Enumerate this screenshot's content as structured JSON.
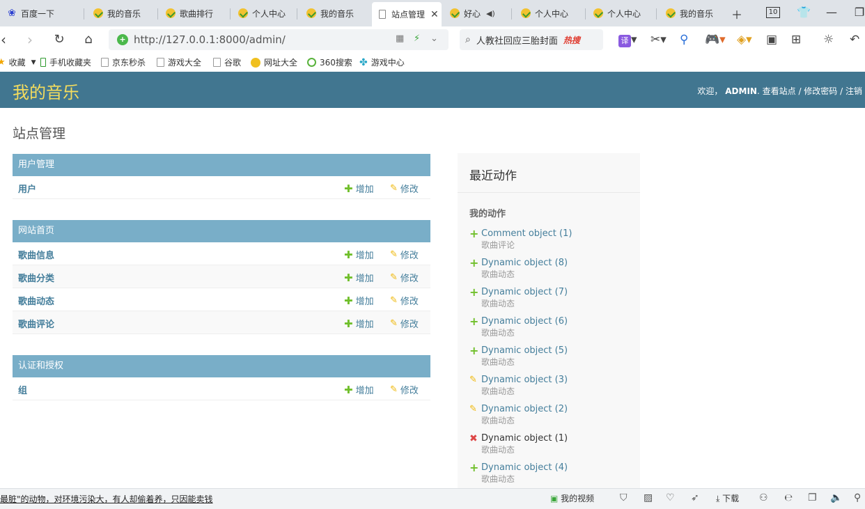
{
  "browser": {
    "tabs": [
      {
        "label": "百度一下",
        "icon": "paw-icon"
      },
      {
        "label": "我的音乐",
        "icon": "site-favicon"
      },
      {
        "label": "歌曲排行",
        "icon": "site-favicon"
      },
      {
        "label": "个人中心",
        "icon": "site-favicon"
      },
      {
        "label": "我的音乐",
        "icon": "site-favicon"
      },
      {
        "label": "站点管理",
        "icon": "page-icon",
        "active": true
      },
      {
        "label": "好心",
        "icon": "site-favicon"
      },
      {
        "label": "个人中心",
        "icon": "site-favicon"
      },
      {
        "label": "个人中心",
        "icon": "site-favicon"
      },
      {
        "label": "我的音乐",
        "icon": "site-favicon"
      }
    ],
    "tab_count": "10",
    "url": "http://127.0.0.1:8000/admin/",
    "search_text": "人教社回应三胎封面",
    "search_badge": "热搜",
    "translate_label": "译",
    "bookmarks": [
      {
        "label": "收藏",
        "icon": "star-icon"
      },
      {
        "label": "手机收藏夹",
        "icon": "phone-icon"
      },
      {
        "label": "京东秒杀",
        "icon": "page-icon"
      },
      {
        "label": "游戏大全",
        "icon": "page-icon"
      },
      {
        "label": "谷歌",
        "icon": "page-icon"
      },
      {
        "label": "网址大全",
        "icon": "globe-icon"
      },
      {
        "label": "360搜索",
        "icon": "search-ring-icon"
      },
      {
        "label": "游戏中心",
        "icon": "game-icon"
      }
    ]
  },
  "admin": {
    "site_name": "我的音乐",
    "user_tools": {
      "welcome": "欢迎，",
      "username": "ADMIN",
      "view_site": "查看站点",
      "change_password": "修改密码",
      "logout": "注销"
    },
    "page_title": "站点管理",
    "add_label": "增加",
    "change_label": "修改",
    "modules": [
      {
        "caption": "用户管理",
        "rows": [
          "用户"
        ]
      },
      {
        "caption": "网站首页",
        "rows": [
          "歌曲信息",
          "歌曲分类",
          "歌曲动态",
          "歌曲评论"
        ]
      },
      {
        "caption": "认证和授权",
        "rows": [
          "组"
        ]
      }
    ],
    "recent_actions": {
      "title": "最近动作",
      "subtitle": "我的动作",
      "items": [
        {
          "action": "add",
          "title": "Comment object (1)",
          "type": "歌曲评论"
        },
        {
          "action": "add",
          "title": "Dynamic object (8)",
          "type": "歌曲动态"
        },
        {
          "action": "add",
          "title": "Dynamic object (7)",
          "type": "歌曲动态"
        },
        {
          "action": "add",
          "title": "Dynamic object (6)",
          "type": "歌曲动态"
        },
        {
          "action": "add",
          "title": "Dynamic object (5)",
          "type": "歌曲动态"
        },
        {
          "action": "change",
          "title": "Dynamic object (3)",
          "type": "歌曲动态"
        },
        {
          "action": "change",
          "title": "Dynamic object (2)",
          "type": "歌曲动态"
        },
        {
          "action": "delete",
          "title": "Dynamic object (1)",
          "type": "歌曲动态"
        },
        {
          "action": "add",
          "title": "Dynamic object (4)",
          "type": "歌曲动态"
        }
      ]
    }
  },
  "statusbar": {
    "ticker": "最脏\"的动物，对环境污染大，有人却偷着养，只因能卖钱",
    "my_video": "我的视频",
    "download": "下载"
  },
  "colors": {
    "header_bg": "#417690",
    "site_name": "#f5dd5d",
    "module_caption_bg": "#79aec8",
    "link": "#447e9b",
    "add_icon": "#70bf2b",
    "change_icon": "#efb80b",
    "delete_icon": "#dd4646"
  }
}
